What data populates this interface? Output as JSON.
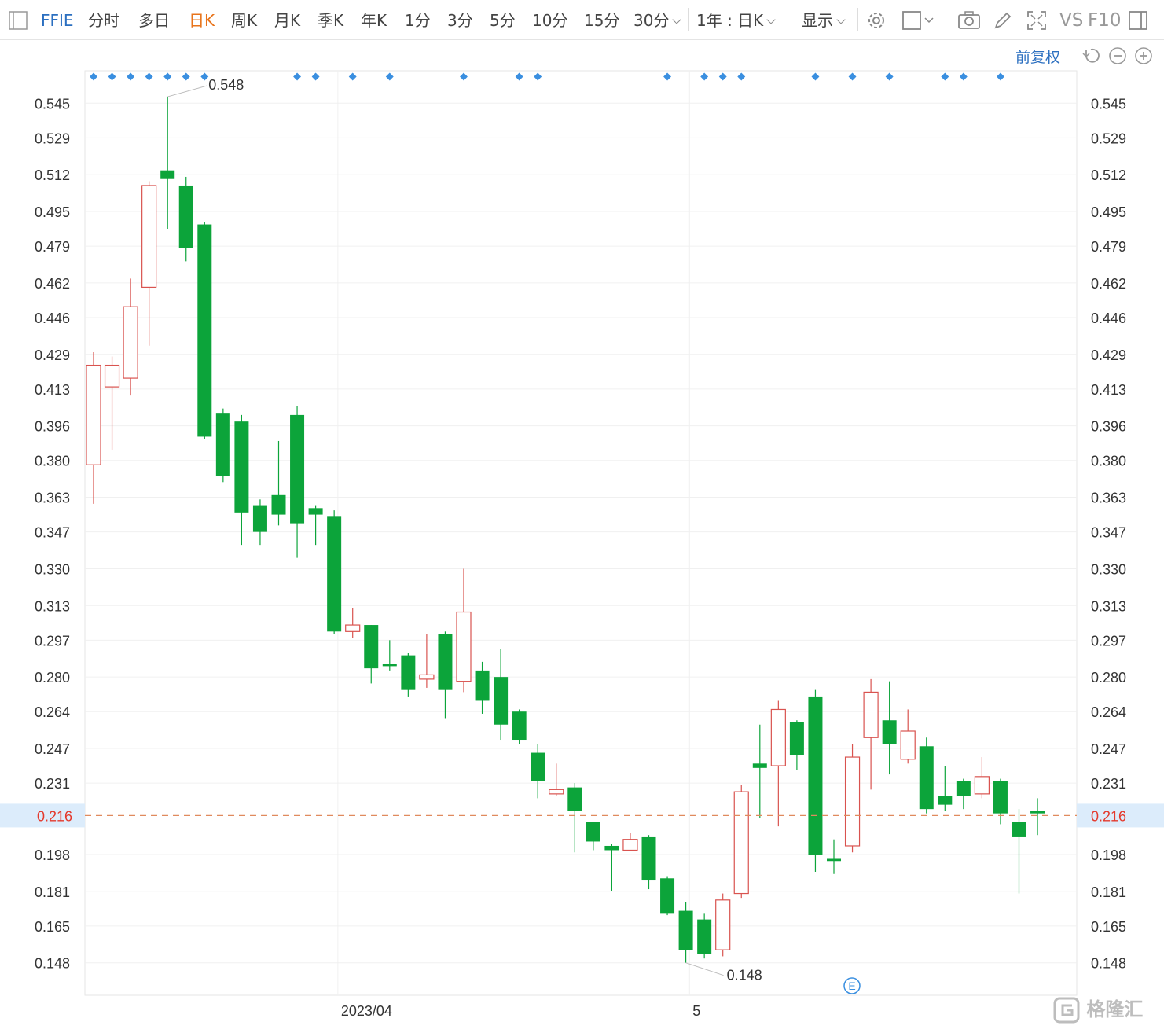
{
  "toolbar": {
    "symbol": "FFIE",
    "tabs": [
      "分时",
      "多日",
      "日K",
      "周K",
      "月K",
      "季K",
      "年K",
      "1分",
      "3分",
      "5分",
      "10分",
      "15分",
      "30分"
    ],
    "active_tab": "日K",
    "period_select": "1年 : 日K",
    "display_label": "显示",
    "vs_label": "VS",
    "f10_label": "F10"
  },
  "adjust_label": "前复权",
  "watermark": "格隆汇",
  "colors": {
    "up": "#d9534f",
    "down": "#0ca43a",
    "dots": "#3a8fe0",
    "current": "#e4392c",
    "accent": "#e8741b",
    "blue": "#2b6fc0"
  },
  "chart_data": {
    "type": "candlestick",
    "y_ticks": [
      "0.545",
      "0.529",
      "0.512",
      "0.495",
      "0.479",
      "0.462",
      "0.446",
      "0.429",
      "0.413",
      "0.396",
      "0.380",
      "0.363",
      "0.347",
      "0.330",
      "0.313",
      "0.297",
      "0.280",
      "0.264",
      "0.247",
      "0.231",
      "0.198",
      "0.181",
      "0.165",
      "0.148"
    ],
    "ylim": [
      0.133,
      0.56
    ],
    "x_labels": [
      {
        "index": 13.2,
        "label": "2023/04"
      },
      {
        "index": 32.2,
        "label": "5"
      }
    ],
    "current_price": "0.216",
    "max_label": "0.548",
    "min_label": "0.148",
    "event_marker": "E",
    "dot_indices": [
      0,
      1,
      2,
      3,
      4,
      5,
      6,
      11,
      12,
      14,
      16,
      20,
      23,
      24,
      31,
      33,
      34,
      35,
      39,
      41,
      43,
      46,
      47,
      49
    ],
    "candles": [
      {
        "o": 0.378,
        "c": 0.424,
        "h": 0.43,
        "l": 0.36
      },
      {
        "o": 0.414,
        "c": 0.424,
        "h": 0.428,
        "l": 0.385
      },
      {
        "o": 0.418,
        "c": 0.451,
        "h": 0.464,
        "l": 0.41
      },
      {
        "o": 0.46,
        "c": 0.507,
        "h": 0.509,
        "l": 0.433
      },
      {
        "o": 0.514,
        "c": 0.51,
        "h": 0.548,
        "l": 0.487
      },
      {
        "o": 0.507,
        "c": 0.478,
        "h": 0.511,
        "l": 0.472
      },
      {
        "o": 0.489,
        "c": 0.391,
        "h": 0.49,
        "l": 0.39
      },
      {
        "o": 0.402,
        "c": 0.373,
        "h": 0.404,
        "l": 0.37
      },
      {
        "o": 0.398,
        "c": 0.356,
        "h": 0.401,
        "l": 0.341
      },
      {
        "o": 0.359,
        "c": 0.347,
        "h": 0.362,
        "l": 0.341
      },
      {
        "o": 0.364,
        "c": 0.355,
        "h": 0.389,
        "l": 0.35
      },
      {
        "o": 0.401,
        "c": 0.351,
        "h": 0.405,
        "l": 0.335
      },
      {
        "o": 0.358,
        "c": 0.355,
        "h": 0.359,
        "l": 0.341
      },
      {
        "o": 0.354,
        "c": 0.301,
        "h": 0.357,
        "l": 0.3
      },
      {
        "o": 0.301,
        "c": 0.304,
        "h": 0.312,
        "l": 0.298
      },
      {
        "o": 0.304,
        "c": 0.284,
        "h": 0.304,
        "l": 0.277
      },
      {
        "o": 0.286,
        "c": 0.285,
        "h": 0.297,
        "l": 0.283
      },
      {
        "o": 0.29,
        "c": 0.274,
        "h": 0.291,
        "l": 0.271
      },
      {
        "o": 0.279,
        "c": 0.281,
        "h": 0.3,
        "l": 0.275
      },
      {
        "o": 0.3,
        "c": 0.274,
        "h": 0.301,
        "l": 0.261
      },
      {
        "o": 0.278,
        "c": 0.31,
        "h": 0.33,
        "l": 0.273
      },
      {
        "o": 0.283,
        "c": 0.269,
        "h": 0.287,
        "l": 0.263
      },
      {
        "o": 0.28,
        "c": 0.258,
        "h": 0.293,
        "l": 0.251
      },
      {
        "o": 0.264,
        "c": 0.251,
        "h": 0.265,
        "l": 0.249
      },
      {
        "o": 0.245,
        "c": 0.232,
        "h": 0.249,
        "l": 0.224
      },
      {
        "o": 0.226,
        "c": 0.228,
        "h": 0.24,
        "l": 0.225
      },
      {
        "o": 0.229,
        "c": 0.218,
        "h": 0.231,
        "l": 0.199
      },
      {
        "o": 0.213,
        "c": 0.204,
        "h": 0.213,
        "l": 0.2
      },
      {
        "o": 0.202,
        "c": 0.2,
        "h": 0.203,
        "l": 0.181
      },
      {
        "o": 0.2,
        "c": 0.205,
        "h": 0.208,
        "l": 0.2
      },
      {
        "o": 0.206,
        "c": 0.186,
        "h": 0.207,
        "l": 0.182
      },
      {
        "o": 0.187,
        "c": 0.171,
        "h": 0.188,
        "l": 0.17
      },
      {
        "o": 0.172,
        "c": 0.154,
        "h": 0.176,
        "l": 0.148
      },
      {
        "o": 0.168,
        "c": 0.152,
        "h": 0.171,
        "l": 0.15
      },
      {
        "o": 0.154,
        "c": 0.177,
        "h": 0.18,
        "l": 0.151
      },
      {
        "o": 0.18,
        "c": 0.227,
        "h": 0.23,
        "l": 0.178
      },
      {
        "o": 0.24,
        "c": 0.238,
        "h": 0.258,
        "l": 0.215
      },
      {
        "o": 0.239,
        "c": 0.265,
        "h": 0.269,
        "l": 0.211
      },
      {
        "o": 0.259,
        "c": 0.244,
        "h": 0.26,
        "l": 0.237
      },
      {
        "o": 0.271,
        "c": 0.198,
        "h": 0.274,
        "l": 0.19
      },
      {
        "o": 0.196,
        "c": 0.195,
        "h": 0.205,
        "l": 0.189
      },
      {
        "o": 0.202,
        "c": 0.243,
        "h": 0.249,
        "l": 0.199
      },
      {
        "o": 0.252,
        "c": 0.273,
        "h": 0.279,
        "l": 0.228
      },
      {
        "o": 0.26,
        "c": 0.249,
        "h": 0.278,
        "l": 0.235
      },
      {
        "o": 0.242,
        "c": 0.255,
        "h": 0.265,
        "l": 0.24
      },
      {
        "o": 0.248,
        "c": 0.219,
        "h": 0.252,
        "l": 0.217
      },
      {
        "o": 0.225,
        "c": 0.221,
        "h": 0.239,
        "l": 0.218
      },
      {
        "o": 0.232,
        "c": 0.225,
        "h": 0.233,
        "l": 0.219
      },
      {
        "o": 0.226,
        "c": 0.234,
        "h": 0.243,
        "l": 0.224
      },
      {
        "o": 0.232,
        "c": 0.217,
        "h": 0.233,
        "l": 0.212
      },
      {
        "o": 0.213,
        "c": 0.206,
        "h": 0.219,
        "l": 0.18
      },
      {
        "o": 0.218,
        "c": 0.217,
        "h": 0.224,
        "l": 0.207
      }
    ]
  }
}
